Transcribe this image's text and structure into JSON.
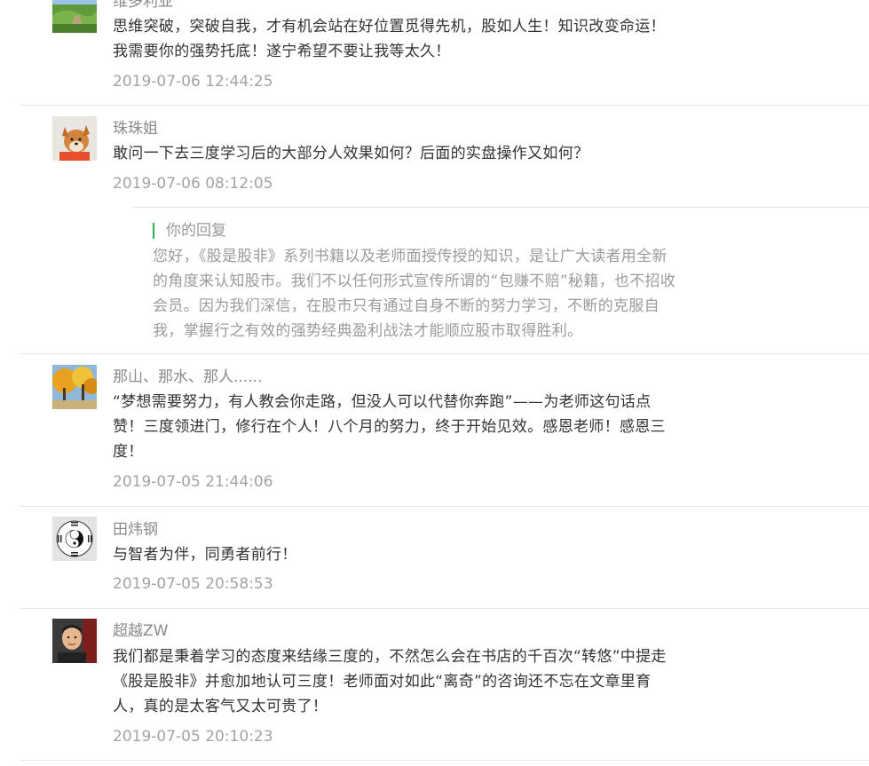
{
  "comments": [
    {
      "name": "维多利亚",
      "text": "思维突破，突破自我，才有机会站在好位置觅得先机，股如人生！知识改变命运！我需要你的强势托底！遂宁希望不要让我等太久！",
      "time": "2019-07-06 12:44:25",
      "avatar_icon": "landscape-avatar-icon"
    },
    {
      "name": "珠珠姐",
      "text": "敢问一下去三度学习后的大部分人效果如何？后面的实盘操作又如何？",
      "time": "2019-07-06 08:12:05",
      "avatar_icon": "dog-avatar-icon",
      "reply": {
        "label": "你的回复",
        "text": "您好，《股是股非》系列书籍以及老师面授传授的知识，是让广大读者用全新的角度来认知股市。我们不以任何形式宣传所谓的“包赚不赔”秘籍，也不招收会员。因为我们深信，在股市只有通过自身不断的努力学习，不断的克服自我，掌握行之有效的强势经典盈利战法才能顺应股市取得胜利。"
      }
    },
    {
      "name": "那山、那水、那人......",
      "text": "“梦想需要努力，有人教会你走路，但没人可以代替你奔跑”——为老师这句话点赞！三度领进门，修行在个人！八个月的努力，终于开始见效。感恩老师！感恩三度！",
      "time": "2019-07-05 21:44:06",
      "avatar_icon": "autumn-trees-avatar-icon"
    },
    {
      "name": "田炜钢",
      "text": "与智者为伴，同勇者前行！",
      "time": "2019-07-05 20:58:53",
      "avatar_icon": "bagua-avatar-icon"
    },
    {
      "name": "超越ZW",
      "text": "我们都是秉着学习的态度来结缘三度的，不然怎么会在书店的千百次“转悠”中提走《股是股非》并愈加地认可三度！老师面对如此“离奇”的咨询还不忘在文章里育人，真的是太客气又太可贵了！",
      "time": "2019-07-05 20:10:23",
      "avatar_icon": "person-avatar-icon"
    }
  ]
}
